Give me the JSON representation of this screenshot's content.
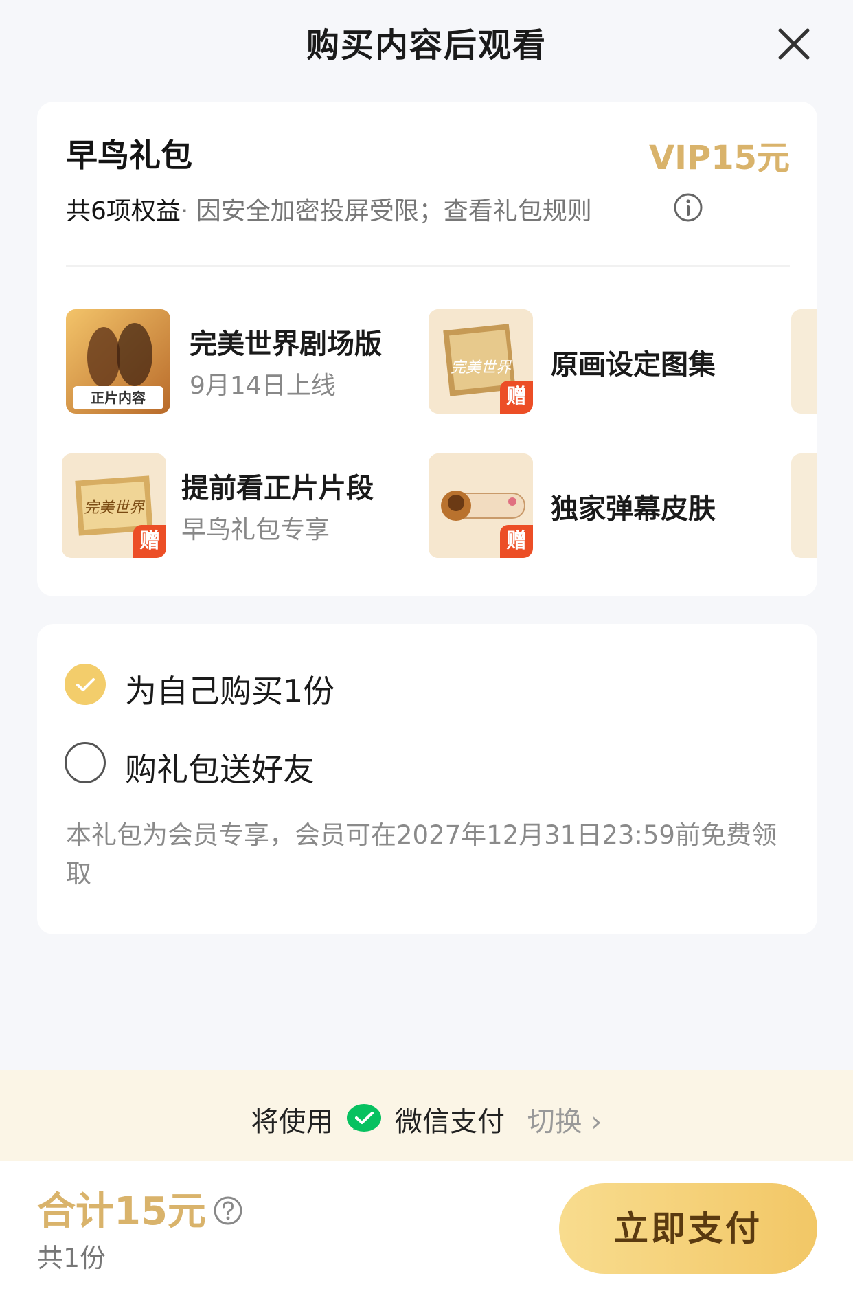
{
  "header": {
    "title": "购买内容后观看"
  },
  "pack": {
    "title": "早鸟礼包",
    "price": "VIP15元",
    "benefit_count": "共6项权益",
    "subtitle": "· 因安全加密投屏受限；查看礼包规则",
    "benefits": [
      {
        "title": "完美世界剧场版",
        "subtitle": "9月14日上线",
        "badge": "正片内容",
        "gift": ""
      },
      {
        "title": "原画设定图集",
        "subtitle": "",
        "badge": "",
        "gift": "赠",
        "art_text": "完美世界"
      },
      {
        "title": "提前看正片片段",
        "subtitle": "早鸟礼包专享",
        "badge": "",
        "gift": "赠",
        "art_text": "完美世界"
      },
      {
        "title": "独家弹幕皮肤",
        "subtitle": "",
        "badge": "",
        "gift": "赠"
      }
    ]
  },
  "options": {
    "self": "为自己购买1份",
    "gift": "购礼包送好友",
    "note": "本礼包为会员专享，会员可在2027年12月31日23:59前免费领取"
  },
  "payment": {
    "prefix": "将使用",
    "method": "微信支付",
    "switch": "切换 ›"
  },
  "footer": {
    "total": "合计15元",
    "copies": "共1份",
    "pay_button": "立即支付"
  },
  "colors": {
    "gold": "#d9b36b",
    "gift_red": "#ec4e26",
    "wechat": "#07c160"
  }
}
